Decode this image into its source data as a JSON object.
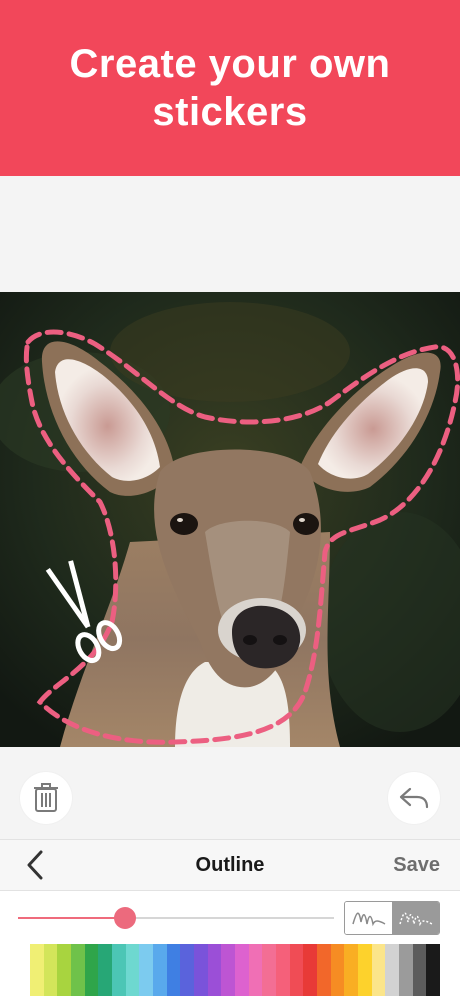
{
  "banner": {
    "title": "Create your own stickers",
    "background": "#f2475a"
  },
  "toolbar": {
    "delete_icon": "trash-icon",
    "undo_icon": "undo-icon"
  },
  "nav": {
    "back_icon": "chevron-left-icon",
    "title": "Outline",
    "save_label": "Save"
  },
  "outline": {
    "thickness_fraction": 0.34,
    "accent_color": "#ec6a7d",
    "styles": [
      {
        "name": "solid",
        "icon": "scribble-solid-icon",
        "selected": false
      },
      {
        "name": "dashed",
        "icon": "scribble-dashed-icon",
        "selected": true
      }
    ]
  },
  "palette": [
    "#f0ef74",
    "#d3e55a",
    "#a8d43f",
    "#6fc24a",
    "#2fa54a",
    "#27a776",
    "#4cc6b5",
    "#6ed8d0",
    "#7ccbef",
    "#59a9ec",
    "#3f7fe3",
    "#5a63dc",
    "#7a53da",
    "#9b4fd7",
    "#bd55d3",
    "#dd62cf",
    "#f06fb5",
    "#f36e94",
    "#f5607a",
    "#f04c55",
    "#e83a37",
    "#f2672a",
    "#f68c23",
    "#f9ae23",
    "#fdd22c",
    "#fbe58a",
    "#d2d2d2",
    "#9b9b9b",
    "#5c5c5c",
    "#1a1a1a"
  ]
}
